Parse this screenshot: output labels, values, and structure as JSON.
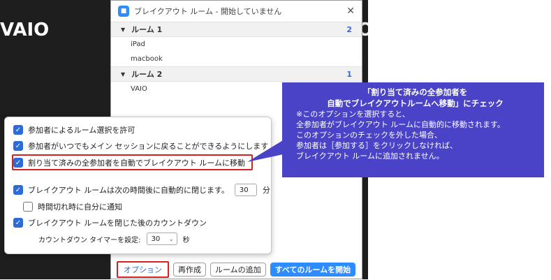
{
  "background": {
    "left_label": "VAIO",
    "right_label": "O"
  },
  "dialog": {
    "title": "ブレイクアウト ルーム - 開始していません",
    "close_symbol": "✕",
    "rooms": [
      {
        "name": "ルーム 1",
        "count": "2",
        "participants": [
          "iPad",
          "macbook"
        ]
      },
      {
        "name": "ルーム 2",
        "count": "1",
        "participants": [
          "VAIO"
        ]
      }
    ]
  },
  "options_popup": {
    "allow_choose_room": "参加者によるルーム選択を許可",
    "allow_return": "参加者がいつでもメイン セッションに戻ることができるようにします",
    "auto_move": "割り当て済みの全参加者を自動でブレイクアウト ルームに移動",
    "auto_close_label": "ブレイクアウト ルームは次の時間後に自動的に閉じます。",
    "auto_close_value": "30",
    "auto_close_unit": "分",
    "notify_timeout": "時間切れ時に自分に通知",
    "countdown_label": "ブレイクアウト ルームを閉じた後のカウントダウン",
    "countdown_timer_label": "カウントダウン タイマーを設定:",
    "countdown_value": "30",
    "countdown_unit": "秒"
  },
  "footer": {
    "options": "オプション",
    "recreate": "再作成",
    "add_room": "ルームの追加",
    "open_all": "すべてのルームを開始"
  },
  "callout": {
    "heading1": "「割り当て済みの全参加者を",
    "heading2": "自動でブレイクアウトルームへ移動」にチェック",
    "line1": "※このオプションを選択すると、",
    "line2": "全参加者がブレイクアウト ルームに自動的に移動されます。",
    "line3": "このオプションのチェックを外した場合、",
    "line4": "参加者は［参加する］をクリックしなければ、",
    "line5": "ブレイクアウト ルームに追加されません。"
  },
  "colors": {
    "accent_blue": "#2d8cff",
    "checkbox_blue": "#2d6bd9",
    "highlight_red": "#d82020",
    "callout_purple": "#4a43c8"
  }
}
